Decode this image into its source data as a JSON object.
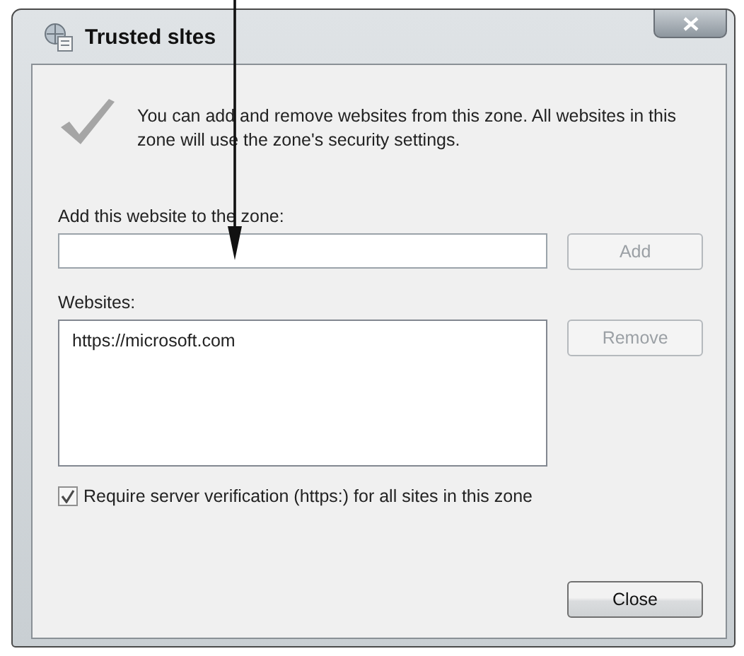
{
  "window": {
    "title": "Trusted sltes"
  },
  "intro": "You can add and remove websites from this zone. All websites in this zone will use the zone's security settings.",
  "add_field": {
    "label": "Add this website to the zone:"
  },
  "add_button": {
    "label": "Add",
    "disabled": true
  },
  "websites": {
    "label": "Websites:",
    "items": [
      {
        "text": "https://microsoft.com",
        "selected": false
      }
    ]
  },
  "remove_button": {
    "label": "Remove",
    "disabled": true
  },
  "verification": {
    "label": "Require server verification (https:) for all sites in this zone",
    "checked": true
  },
  "close_button": {
    "label": "Close",
    "disabled": false
  }
}
